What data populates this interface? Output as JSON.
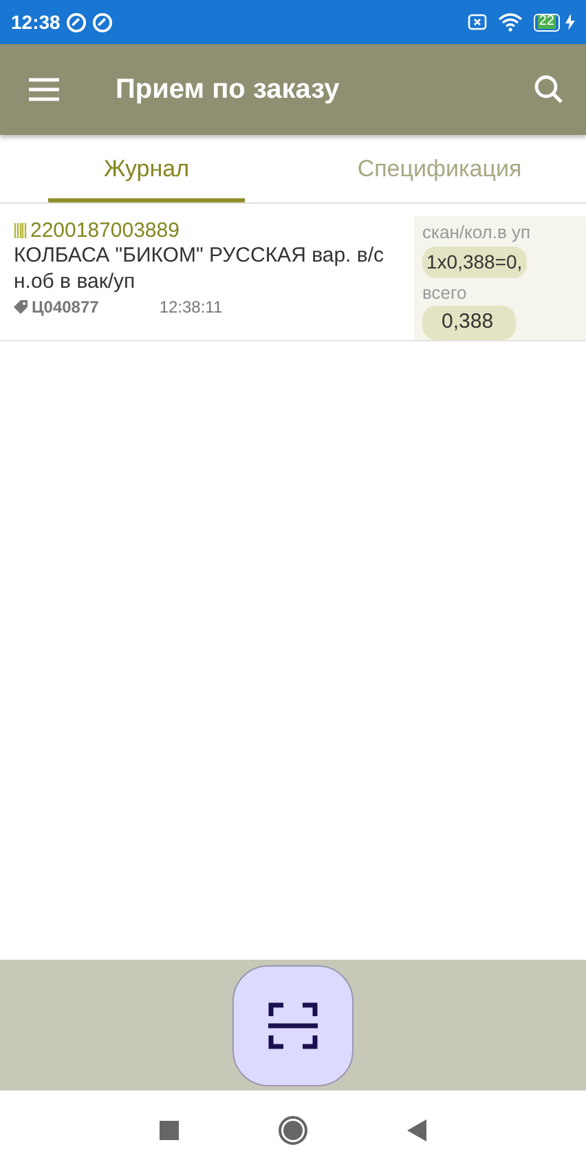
{
  "status_bar": {
    "time": "12:38",
    "battery": "22"
  },
  "app_bar": {
    "title": "Прием по заказу"
  },
  "tabs": [
    {
      "label": "Журнал",
      "selected": true
    },
    {
      "label": "Спецификация",
      "selected": false
    }
  ],
  "entries": [
    {
      "barcode": "2200187003889",
      "name": "КОЛБАСА \"БИКОМ\" РУССКАЯ вар. в/с н.об в вак/уп",
      "code": "Ц040877",
      "time": "12:38:11",
      "scan_label": "скан/кол.в уп",
      "scan_value": "1x0,388=0,",
      "total_label": "всего",
      "total_value": "0,388"
    }
  ]
}
